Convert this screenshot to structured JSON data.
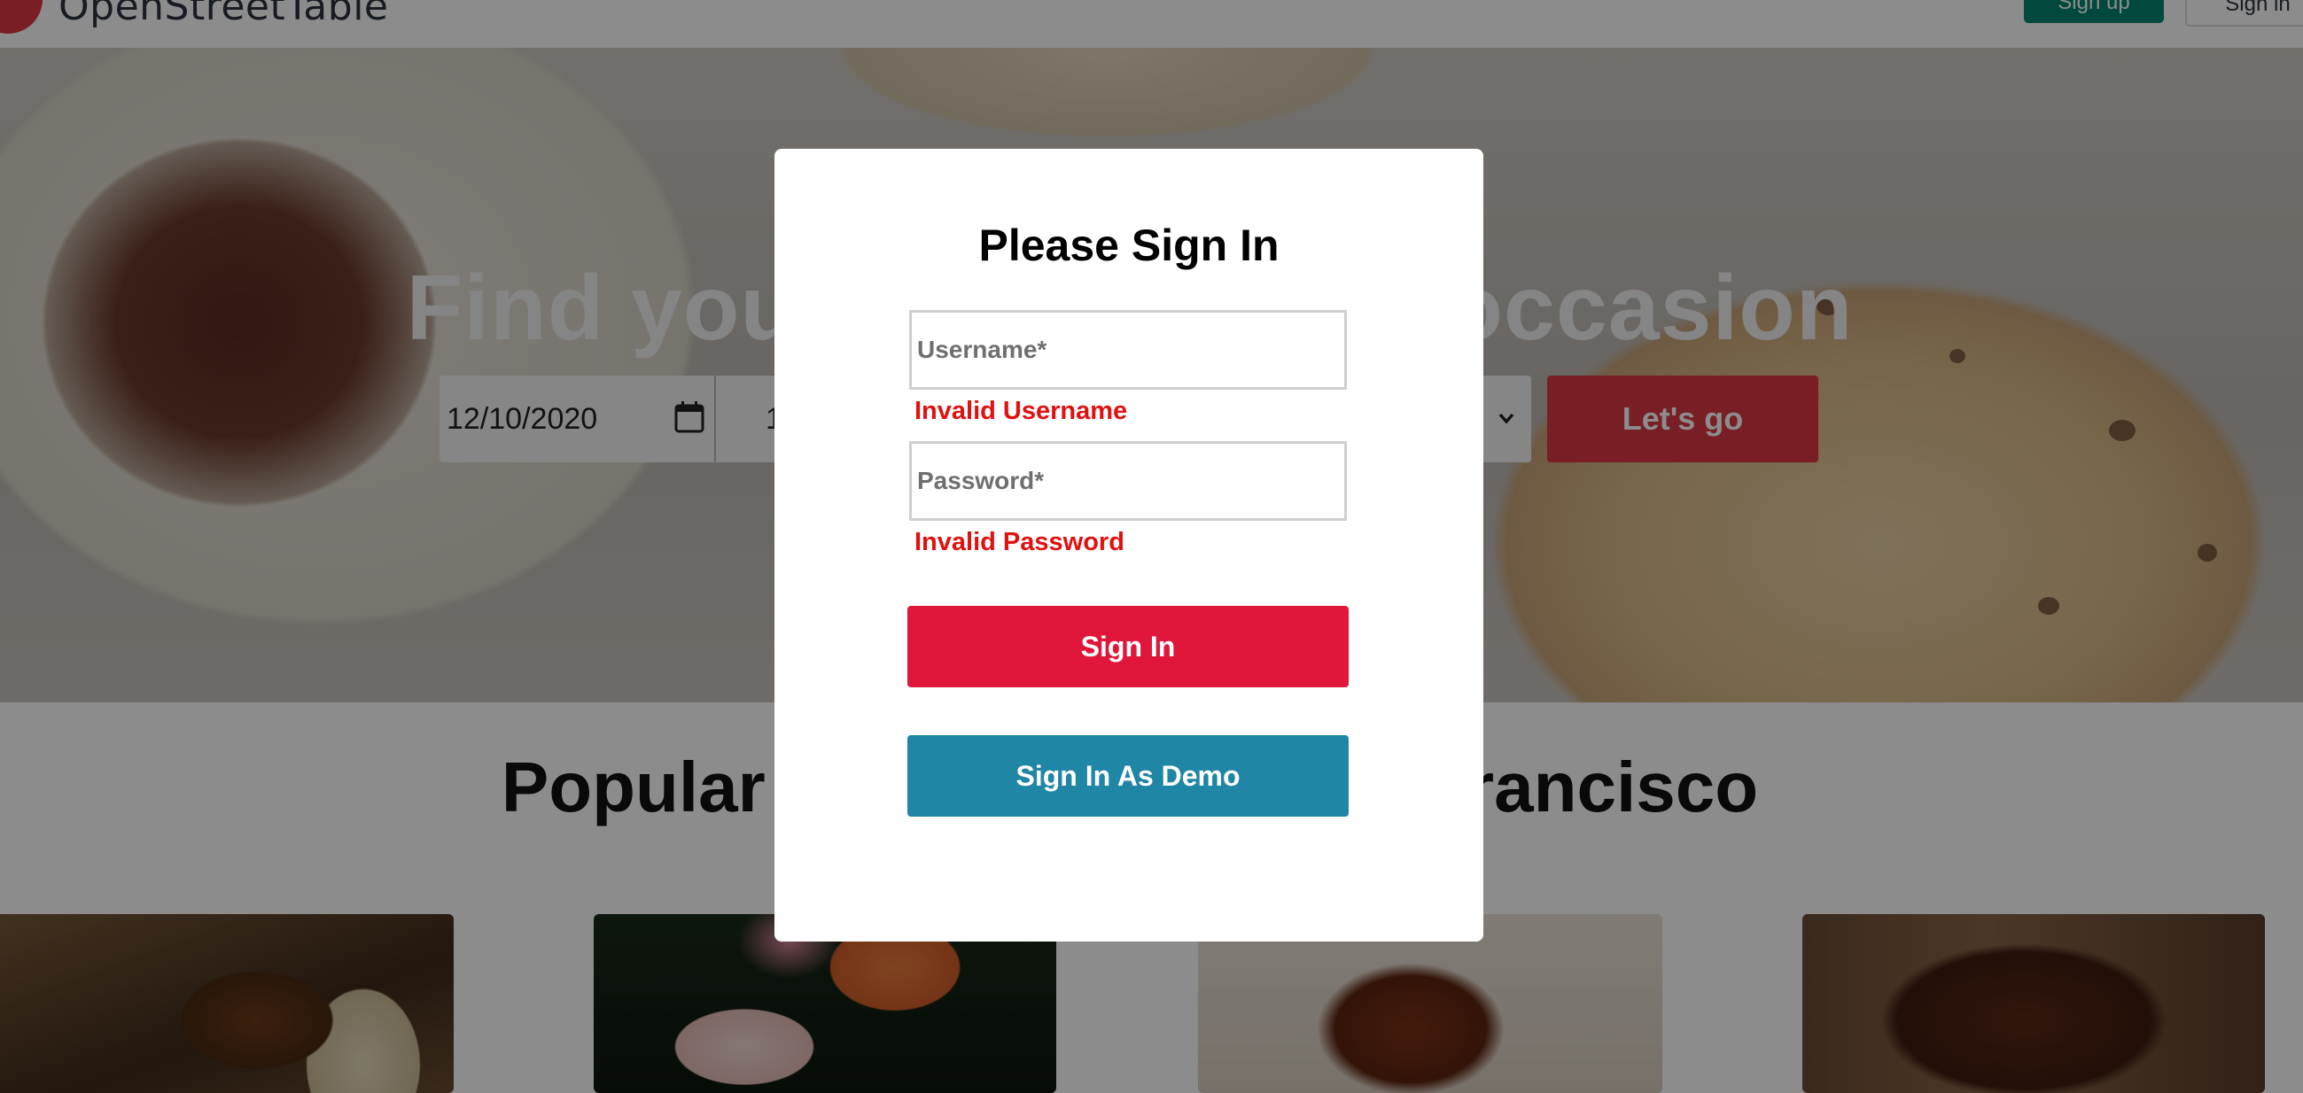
{
  "nav": {
    "brand": "OpenStreetTable",
    "signup_label": "Sign up",
    "signin_label": "Sign in"
  },
  "hero": {
    "headline": "Find your table for any occasion",
    "date_value": "12/10/2020",
    "time_value": "1",
    "cta_label": "Let's go"
  },
  "popular": {
    "title": "Popular restaurants in San Francisco"
  },
  "modal": {
    "title": "Please Sign In",
    "username_placeholder": "Username*",
    "username_error": "Invalid Username",
    "password_placeholder": "Password*",
    "password_error": "Invalid Password",
    "signin_label": "Sign In",
    "demo_label": "Sign In As Demo"
  },
  "colors": {
    "brand_red": "#da3743",
    "signin_red": "#e0173b",
    "demo_blue": "#1f86a5",
    "error_red": "#e0110f",
    "signup_green": "#00866d"
  }
}
